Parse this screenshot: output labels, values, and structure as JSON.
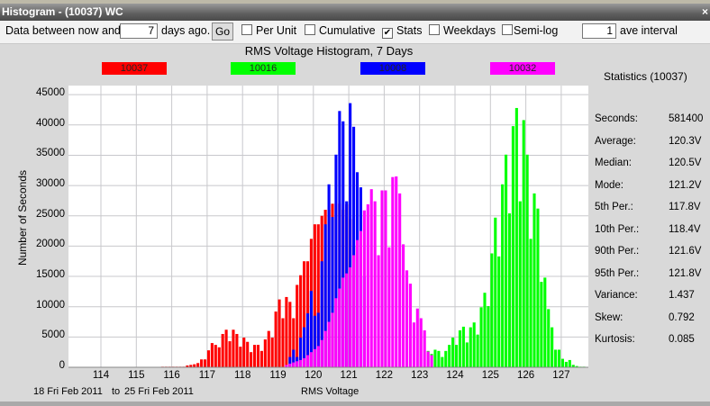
{
  "window": {
    "title": "Histogram - (10037) WC",
    "close_label": "×"
  },
  "toolbar": {
    "data_between_label": "Data between now and",
    "days_value": "7",
    "days_ago_label": "days ago.",
    "go_label": "Go",
    "per_unit_label": "Per Unit",
    "per_unit_checked": false,
    "cumulative_label": "Cumulative",
    "cumulative_checked": false,
    "stats_label": "Stats",
    "stats_checked": true,
    "weekdays_label": "Weekdays",
    "weekdays_checked": false,
    "semilog_label": "Semi-log",
    "semilog_checked": false,
    "ave_value": "1",
    "ave_interval_label": "ave interval",
    "check_mark": "✔"
  },
  "statistics": {
    "title": "Statistics (10037)",
    "rows": [
      {
        "label": "Seconds:",
        "value": "581400"
      },
      {
        "label": "Average:",
        "value": "120.3V"
      },
      {
        "label": "Median:",
        "value": "120.5V"
      },
      {
        "label": "Mode:",
        "value": "121.2V"
      },
      {
        "label": "5th Per.:",
        "value": "117.8V"
      },
      {
        "label": "10th Per.:",
        "value": "118.4V"
      },
      {
        "label": "90th Per.:",
        "value": "121.6V"
      },
      {
        "label": "95th Per.:",
        "value": "121.8V"
      },
      {
        "label": "Variance:",
        "value": "1.437"
      },
      {
        "label": "Skew:",
        "value": "0.792"
      },
      {
        "label": "Kurtosis:",
        "value": "0.085"
      }
    ]
  },
  "footer": {
    "from": "18 Fri Feb 2011",
    "to_label": "to",
    "to": "25 Fri Feb 2011"
  },
  "chart_data": {
    "type": "bar",
    "title": "RMS Voltage Histogram, 7 Days",
    "xlabel": "RMS Voltage",
    "ylabel": "Number of Seconds",
    "xlim": [
      113.1,
      127.8
    ],
    "ylim": [
      0,
      45000
    ],
    "bin_width": 0.1,
    "grid": true,
    "legend_placement": "top",
    "x_ticks": [
      114,
      115,
      116,
      117,
      118,
      119,
      120,
      121,
      122,
      123,
      124,
      125,
      126,
      127
    ],
    "y_ticks": [
      0,
      5000,
      10000,
      15000,
      20000,
      25000,
      30000,
      35000,
      40000,
      45000
    ],
    "series": [
      {
        "name": "10037",
        "color": "#ff0000",
        "start": 115.7,
        "values": [
          100,
          100,
          100,
          100,
          100,
          100,
          100,
          300,
          400,
          500,
          700,
          1300,
          1300,
          2800,
          4000,
          3700,
          3300,
          5500,
          6200,
          4300,
          6200,
          5500,
          3400,
          4900,
          4200,
          2500,
          3700,
          3700,
          2700,
          4600,
          6000,
          4900,
          9200,
          11200,
          8100,
          11600,
          10800,
          8100,
          13600,
          15200,
          17500,
          17500,
          21200,
          23600,
          23600,
          25000,
          26000,
          26000,
          27000,
          27000,
          27000,
          26000,
          26900,
          24500,
          20000
        ]
      },
      {
        "name": "10016",
        "color": "#00ff00",
        "start": 123.2,
        "values": [
          2700,
          2200,
          2900,
          2700,
          1700,
          2700,
          3700,
          4900,
          3700,
          6100,
          6700,
          4100,
          6600,
          7400,
          5400,
          9900,
          12300,
          10100,
          18800,
          24700,
          18300,
          30200,
          35100,
          25400,
          39800,
          42800,
          27400,
          40800,
          35100,
          21200,
          28700,
          26200,
          14100,
          14800,
          9600,
          6600,
          2900,
          2900,
          1400,
          900,
          1200,
          400,
          200,
          100,
          100
        ]
      },
      {
        "name": "10008",
        "color": "#0000ff",
        "start": 119.3,
        "values": [
          1700,
          2900,
          1700,
          4900,
          6600,
          8900,
          12600,
          8500,
          9000,
          17500,
          23600,
          30200,
          24800,
          35100,
          42300,
          40600,
          27400,
          43600,
          39700,
          32200,
          29700,
          15000
        ]
      },
      {
        "name": "10032",
        "color": "#ff00ff",
        "start": 119.2,
        "values": [
          400,
          600,
          800,
          1000,
          1200,
          1500,
          2000,
          2500,
          3000,
          3500,
          4500,
          6000,
          7500,
          9000,
          11400,
          13000,
          14800,
          15500,
          16500,
          18500,
          21000,
          22500,
          25900,
          26900,
          29400,
          27400,
          18500,
          29200,
          29200,
          19800,
          31400,
          31500,
          28700,
          20300,
          16000,
          13800,
          7400,
          9700,
          8100,
          6100,
          2600,
          2000
        ]
      }
    ]
  }
}
